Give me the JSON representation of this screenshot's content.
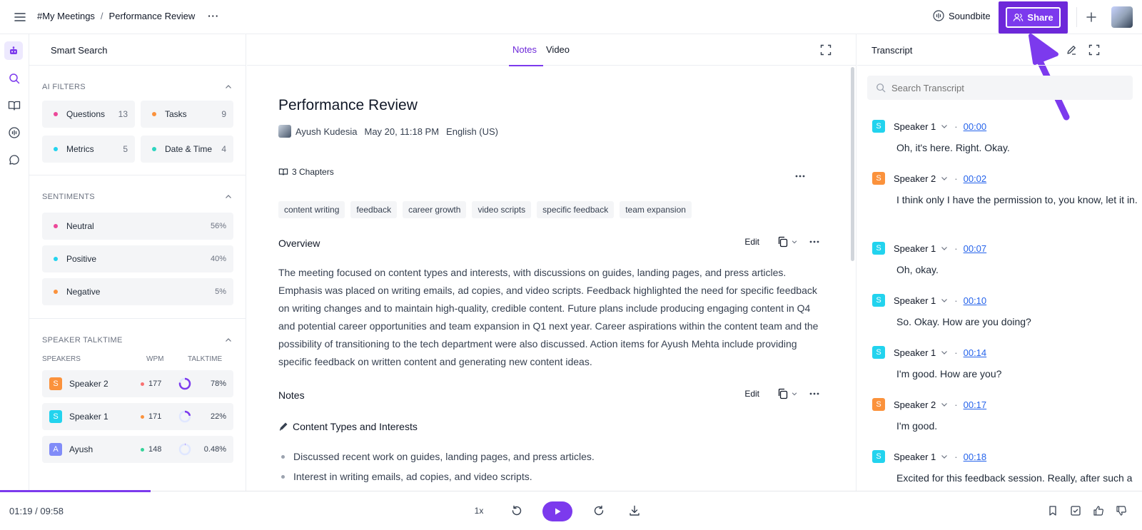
{
  "topbar": {
    "breadcrumb": [
      "#My Meetings",
      "Performance Review"
    ],
    "separator": "/",
    "more": "···",
    "soundbite_label": "Soundbite",
    "share_label": "Share"
  },
  "left": {
    "title": "Smart Search",
    "ai_filters": {
      "title": "AI FILTERS",
      "items": [
        {
          "label": "Questions",
          "count": "13",
          "color": "#ec4899"
        },
        {
          "label": "Tasks",
          "count": "9",
          "color": "#fb923c"
        },
        {
          "label": "Metrics",
          "count": "5",
          "color": "#22d3ee"
        },
        {
          "label": "Date & Time",
          "count": "4",
          "color": "#2dd4bf"
        }
      ]
    },
    "sentiments": {
      "title": "SENTIMENTS",
      "items": [
        {
          "label": "Neutral",
          "pct": "56%",
          "color": "#ec4899"
        },
        {
          "label": "Positive",
          "pct": "40%",
          "color": "#22d3ee"
        },
        {
          "label": "Negative",
          "pct": "5%",
          "color": "#fb923c"
        }
      ]
    },
    "talktime": {
      "title": "SPEAKER TALKTIME",
      "col_speakers": "SPEAKERS",
      "col_wpm": "WPM",
      "col_talktime": "TALKTIME",
      "rows": [
        {
          "initial": "S",
          "name": "Speaker 2",
          "wpm": "177",
          "talktime": "78%",
          "share": 0.78,
          "badge": "#fb923c",
          "dot": "#f87171"
        },
        {
          "initial": "S",
          "name": "Speaker 1",
          "wpm": "171",
          "talktime": "22%",
          "share": 0.22,
          "badge": "#22d3ee",
          "dot": "#fb923c"
        },
        {
          "initial": "A",
          "name": "Ayush",
          "wpm": "148",
          "talktime": "0.48%",
          "share": 0.0048,
          "badge": "#818cf8",
          "dot": "#34d399"
        }
      ]
    }
  },
  "center": {
    "tabs": [
      "Notes",
      "Video"
    ],
    "title": "Performance Review",
    "author": "Ayush Kudesia",
    "date": "May 20, 11:18 PM",
    "language": "English (US)",
    "chapters": "3 Chapters",
    "tags": [
      "content writing",
      "feedback",
      "career growth",
      "video scripts",
      "specific feedback",
      "team expansion"
    ],
    "overview_title": "Overview",
    "edit_label": "Edit",
    "overview_text": "The meeting focused on content types and interests, with discussions on guides, landing pages, and press articles. Emphasis was placed on writing emails, ad copies, and video scripts. Feedback highlighted the need for specific feedback on writing changes and to maintain high-quality, credible content. Future plans include producing engaging content in Q4 and potential career opportunities and team expansion in Q1 next year. Career aspirations within the content team and the possibility of transitioning to the tech department were also discussed. Action items for Ayush Mehta include providing specific feedback on written content and generating new content ideas.",
    "notes_title": "Notes",
    "notes_sub": "Content Types and Interests",
    "bullets": [
      "Discussed recent work on guides, landing pages, and press articles.",
      "Interest in writing emails, ad copies, and video scripts."
    ]
  },
  "transcript": {
    "title": "Transcript",
    "search_placeholder": "Search Transcript",
    "separator": "·",
    "utterances": [
      {
        "initial": "S",
        "speaker": "Speaker 1",
        "time": "00:00",
        "text": "Oh, it's here. Right. Okay.",
        "badge": "#22d3ee"
      },
      {
        "initial": "S",
        "speaker": "Speaker 2",
        "time": "00:02",
        "text": "I think only I have the permission to, you know, let it in.",
        "badge": "#fb923c"
      },
      {
        "initial": "S",
        "speaker": "Speaker 1",
        "time": "00:07",
        "text": "Oh, okay.",
        "badge": "#22d3ee"
      },
      {
        "initial": "S",
        "speaker": "Speaker 1",
        "time": "00:10",
        "text": "So. Okay. How are you doing?",
        "badge": "#22d3ee"
      },
      {
        "initial": "S",
        "speaker": "Speaker 1",
        "time": "00:14",
        "text": "I'm good. How are you?",
        "badge": "#22d3ee"
      },
      {
        "initial": "S",
        "speaker": "Speaker 2",
        "time": "00:17",
        "text": "I'm good.",
        "badge": "#fb923c"
      },
      {
        "initial": "S",
        "speaker": "Speaker 1",
        "time": "00:18",
        "text": "Excited for this feedback session. Really, after such a",
        "badge": "#22d3ee"
      }
    ]
  },
  "player": {
    "current": "01:19",
    "duration": "09:58",
    "time_sep": " / ",
    "speed": "1x",
    "progress": 0.132
  },
  "accent": "#7c3aed"
}
